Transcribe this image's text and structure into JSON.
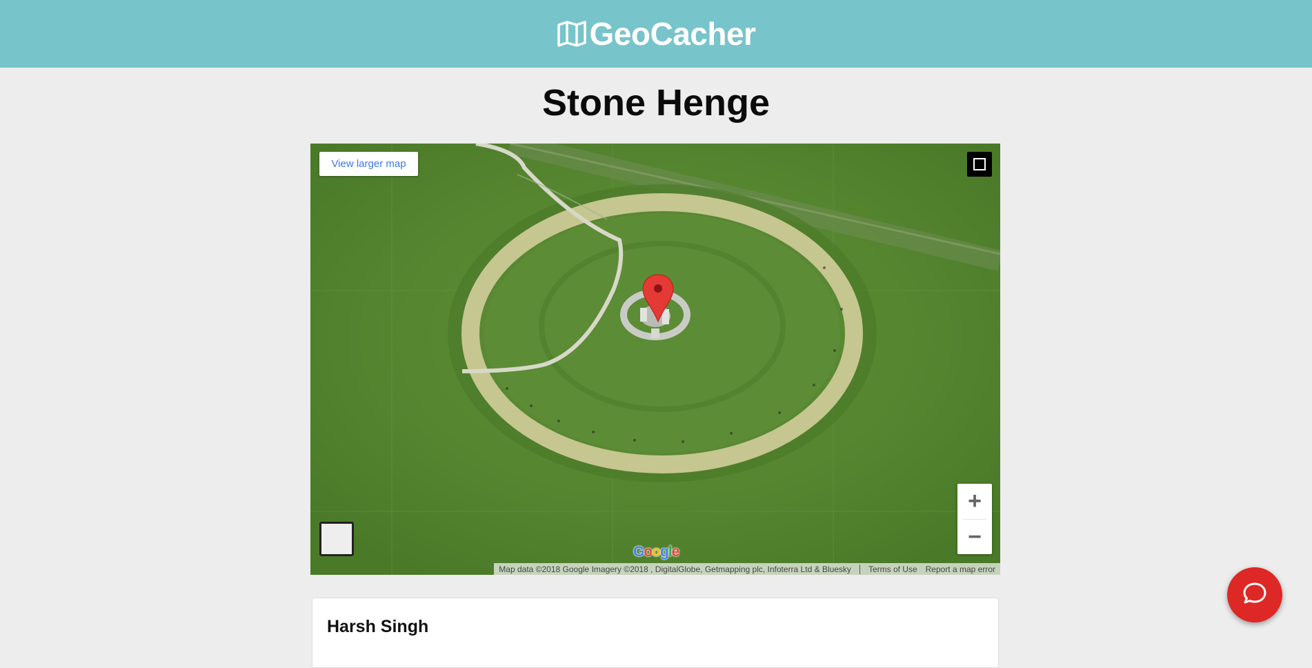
{
  "header": {
    "brand": "GeoCacher",
    "brand_icon": "map-icon",
    "color": "#78c4cb"
  },
  "page": {
    "title": "Stone Henge"
  },
  "map": {
    "view_larger_label": "View larger map",
    "zoom_in_label": "+",
    "zoom_out_label": "−",
    "google_logo": "Google",
    "attribution": {
      "map_data": "Map data ©2018 Google Imagery ©2018 , DigitalGlobe, Getmapping plc, Infoterra Ltd & Bluesky",
      "terms": "Terms of Use",
      "report": "Report a map error"
    },
    "marker_icon": "map-pin-icon",
    "marker_color": "#e53935"
  },
  "owner": {
    "name": "Harsh Singh"
  },
  "chat": {
    "icon": "chat-bubble-icon",
    "color": "#dd2826"
  }
}
